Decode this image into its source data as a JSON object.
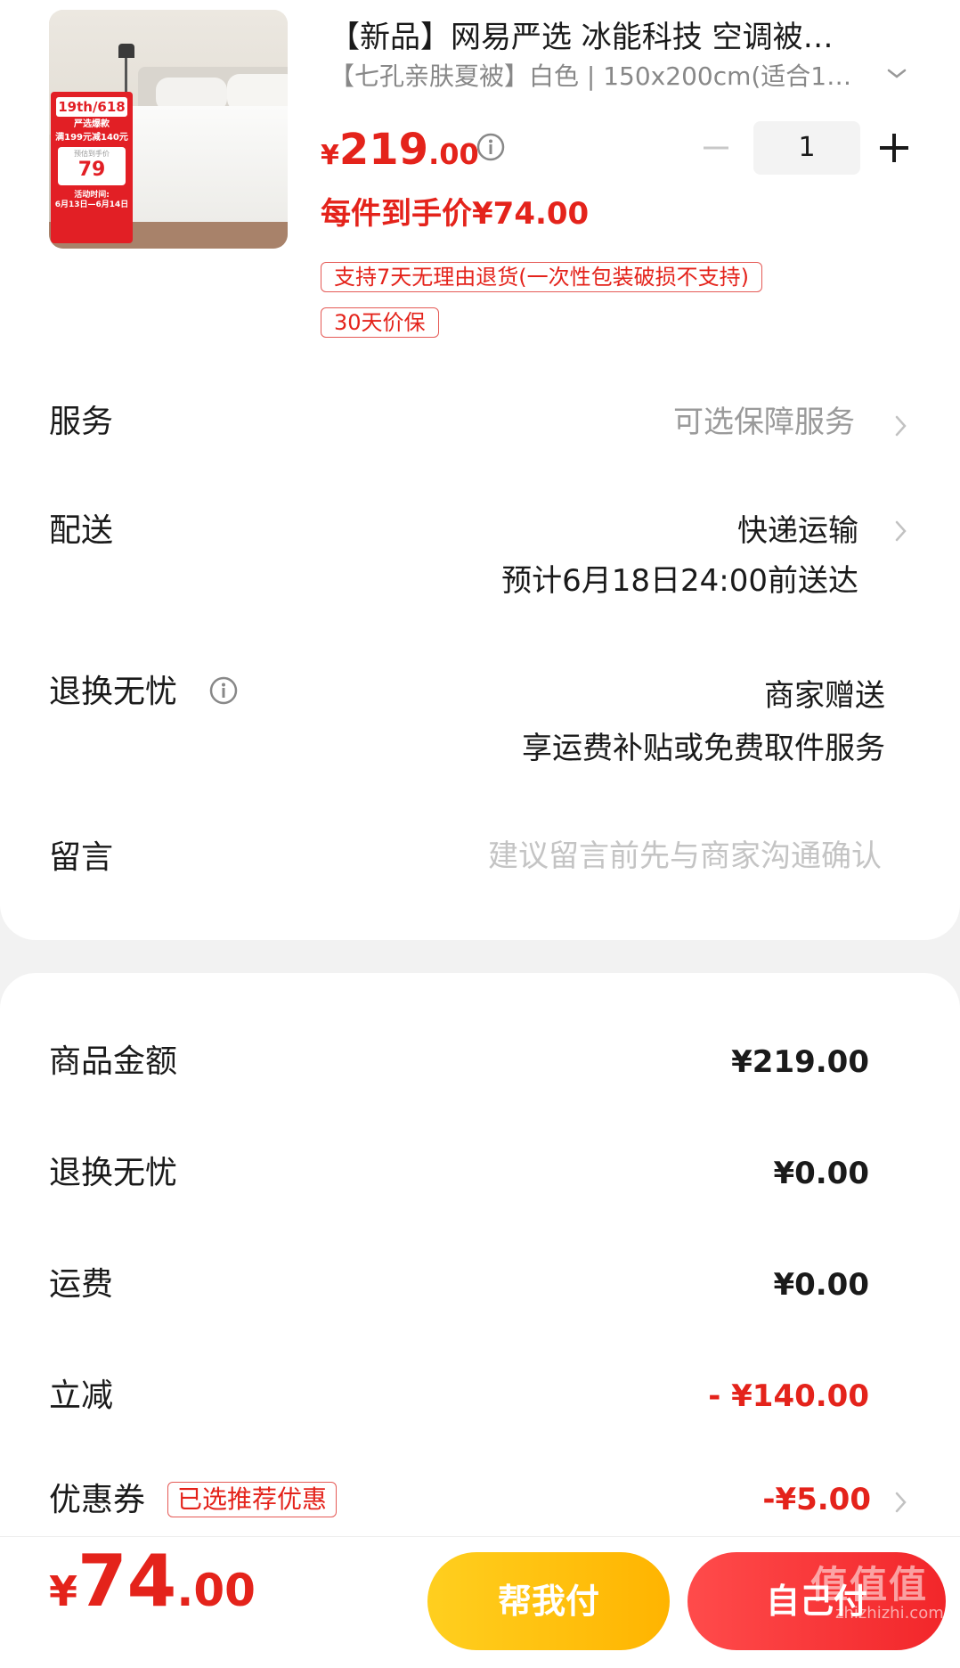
{
  "product": {
    "title": "【新品】网易严选 冰能科技 空调被…",
    "spec": "【七孔亲肤夏被】白色 | 150x200cm(适合1…",
    "price_currency": "¥",
    "price_int": "219",
    "price_dec": ".00",
    "quantity": "1",
    "each_price": "每件到手价¥74.00",
    "tags": [
      "支持7天无理由退货(一次性包装破损不支持)",
      "30天价保"
    ],
    "promo": {
      "head": "19th/618",
      "line1": "严选爆款",
      "line2": "满199元减140元",
      "box_small": "预估到手价",
      "box_price": "79",
      "date_label": "活动时间:",
      "date": "6月13日—6月14日"
    }
  },
  "rows": {
    "service": {
      "label": "服务",
      "value": "可选保障服务"
    },
    "delivery": {
      "label": "配送",
      "value": "快递运输",
      "eta": "预计6月18日24:00前送达"
    },
    "returns": {
      "label": "退换无忧",
      "value": "商家赠送",
      "detail": "享运费补贴或免费取件服务"
    },
    "message": {
      "label": "留言",
      "placeholder": "建议留言前先与商家沟通确认"
    }
  },
  "summary": {
    "goods": {
      "label": "商品金额",
      "value": "¥219.00"
    },
    "returns": {
      "label": "退换无忧",
      "value": "¥0.00"
    },
    "shipping": {
      "label": "运费",
      "value": "¥0.00"
    },
    "discount": {
      "label": "立减",
      "value": "- ¥140.00"
    },
    "coupon": {
      "label": "优惠券",
      "tag": "已选推荐优惠",
      "value": "-¥5.00"
    }
  },
  "footer": {
    "total_currency": "¥",
    "total_int": "74",
    "total_dec": ".00",
    "help_pay": "帮我付",
    "self_pay": "自己付"
  },
  "watermark": {
    "text": "值值值",
    "url": "zhizhizhi.com"
  },
  "colors": {
    "accent": "#e4231b",
    "help_btn": "#ffb400",
    "self_btn": "#f2262a"
  }
}
